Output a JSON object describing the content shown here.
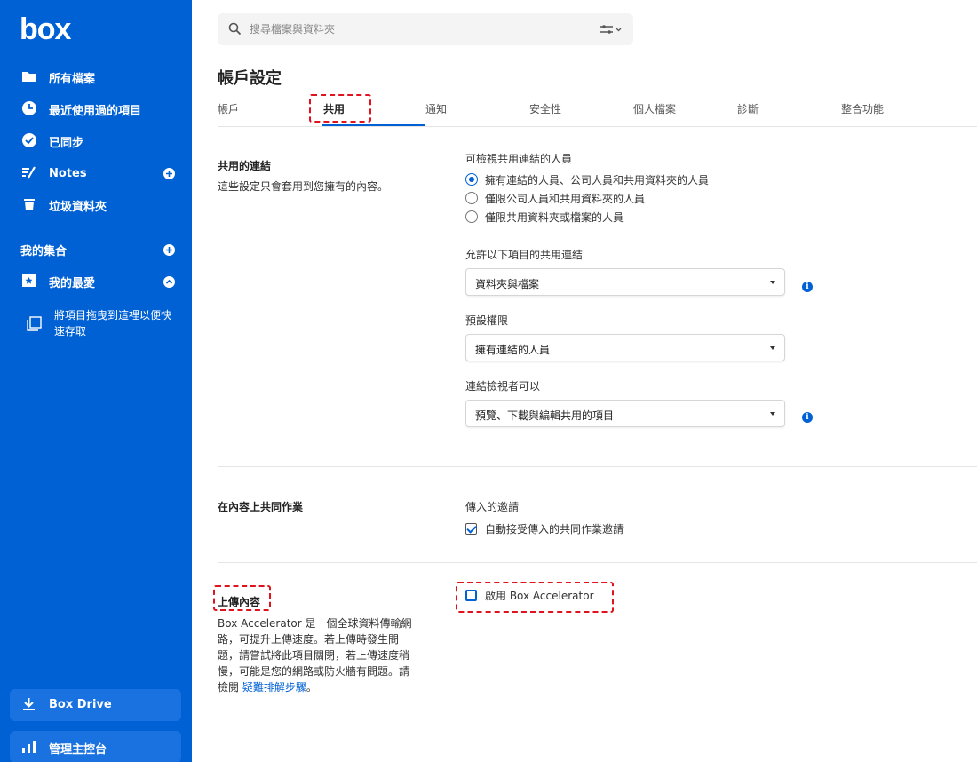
{
  "sidebar": {
    "logo": "box",
    "nav": [
      {
        "label": "所有檔案",
        "icon": "folder-icon"
      },
      {
        "label": "最近使用過的項目",
        "icon": "clock-icon"
      },
      {
        "label": "已同步",
        "icon": "check-circle-icon"
      },
      {
        "label": "Notes",
        "icon": "notes-icon"
      },
      {
        "label": "垃圾資料夾",
        "icon": "trash-icon"
      }
    ],
    "collections_title": "我的集合",
    "favorites_label": "我的最愛",
    "drop_hint": "將項目拖曳到這裡以便快速存取",
    "box_drive_label": "Box Drive",
    "admin_console_label": "管理主控台"
  },
  "search": {
    "placeholder": "搜尋檔案與資料夾"
  },
  "page_title": "帳戶設定",
  "tabs": [
    "帳戶",
    "共用",
    "通知",
    "安全性",
    "個人檔案",
    "診斷",
    "整合功能"
  ],
  "active_tab": "共用",
  "shared_links": {
    "title": "共用的連結",
    "description": "這些設定只會套用到您擁有的內容。",
    "who_can_view_label": "可檢視共用連結的人員",
    "options": [
      "擁有連結的人員、公司人員和共用資料夾的人員",
      "僅限公司人員和共用資料夾的人員",
      "僅限共用資料夾或檔案的人員"
    ],
    "selected_option": 0,
    "allow_links_label": "允許以下項目的共用連結",
    "allow_links_value": "資料夾與檔案",
    "default_permission_label": "預設權限",
    "default_permission_value": "擁有連結的人員",
    "viewers_can_label": "連結檢視者可以",
    "viewers_can_value": "預覽、下載與編輯共用的項目"
  },
  "collaboration": {
    "title": "在內容上共同作業",
    "incoming_label": "傳入的邀請",
    "auto_accept_label": "自動接受傳入的共同作業邀請",
    "auto_accept_checked": true
  },
  "upload": {
    "title": "上傳內容",
    "description": "Box Accelerator 是一個全球資料傳輸網路，可提升上傳速度。若上傳時發生問題，請嘗試將此項目關閉，若上傳速度稍慢，可能是您的網路或防火牆有問題。請檢閱 ",
    "link_text": "疑難排解步驟",
    "description_end": "。",
    "enable_label": "啟用 Box Accelerator",
    "enable_checked": false
  },
  "colors": {
    "brand": "#0061d5",
    "annotation": "#e0121d"
  }
}
